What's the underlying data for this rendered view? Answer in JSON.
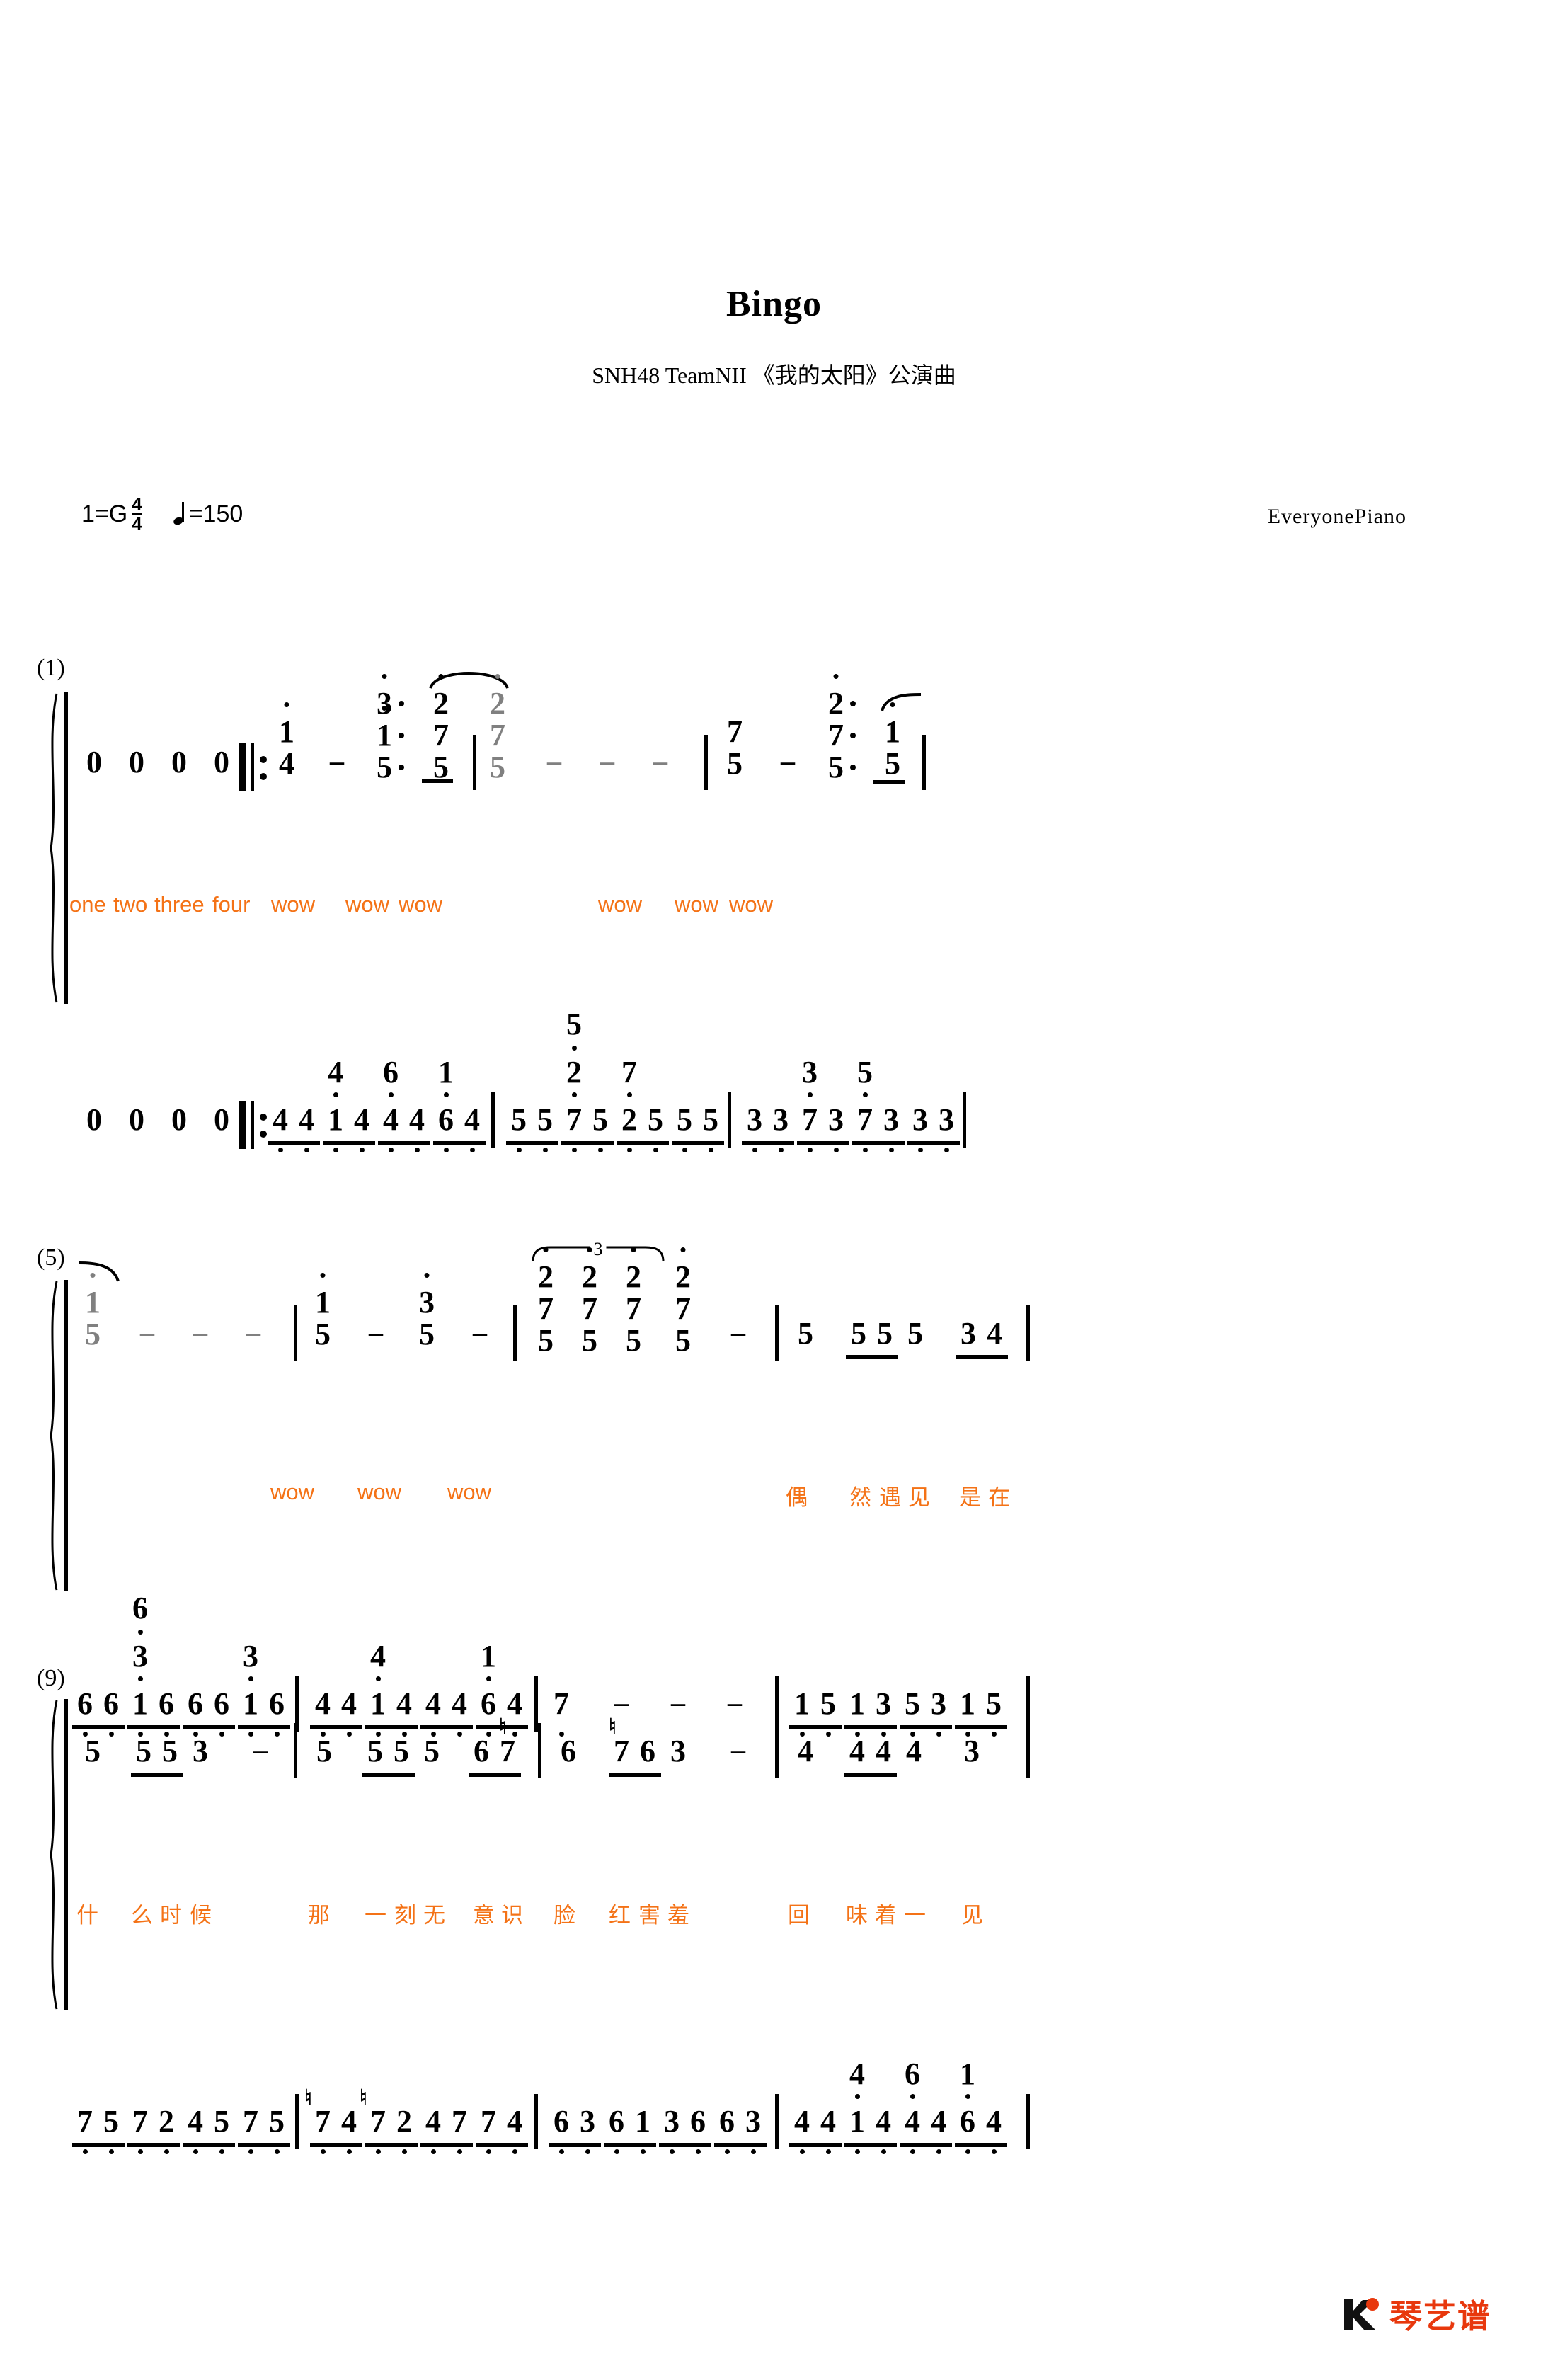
{
  "header": {
    "title": "Bingo",
    "subtitle": "SNH48 TeamNII 《我的太阳》公演曲",
    "key_prefix": "1=G",
    "time_num": "4",
    "time_den": "4",
    "tempo_text": "=150",
    "credit": "EveryonePiano",
    "watermark": "琴艺谱"
  },
  "systems": [
    {
      "number": "(1)",
      "lyrics": [
        "one",
        "two",
        "three",
        "four",
        "wow",
        "wow",
        "wow",
        "wow",
        "wow",
        "wow"
      ],
      "treble": [
        "0",
        "0",
        "0",
        "0",
        "1̇/4",
        "-",
        "3̇·/1̇·/5·",
        "2̇/7/5",
        "2̇/7/5 (tied)",
        "-",
        "-",
        "-",
        "7/5",
        "-",
        "2̇·/7·/5·",
        "1̇/5"
      ],
      "bass": [
        "0",
        "0",
        "0",
        "0",
        "4",
        "4",
        "1̣(4)",
        "4",
        "4",
        "4",
        "6(6)",
        "4",
        "5",
        "5",
        "7(2̇)",
        "5",
        "2",
        "5",
        "5",
        "5",
        "3",
        "3",
        "7(3̇)",
        "3",
        "7(5)",
        "3",
        "3",
        "3"
      ]
    },
    {
      "number": "(5)",
      "lyrics": [
        "wow",
        "wow",
        "wow",
        "偶",
        "然",
        "遇",
        "见",
        "是",
        "在"
      ],
      "treble": [
        "1̇/5 (tied)",
        "-",
        "-",
        "-",
        "1̇/5",
        "-",
        "3̇/5",
        "-",
        "2̇/7/5",
        "2̇/7/5",
        "2̇/7/5",
        "2̇/7/5",
        "-",
        "5",
        "5",
        "5",
        "5",
        "3",
        "4"
      ],
      "bass": [
        "6",
        "6",
        "1̣(6̇/3̇)",
        "6",
        "6",
        "6",
        "1̣(3)",
        "6",
        "4",
        "4",
        "1̣(4)",
        "4",
        "4",
        "4",
        "6(6)",
        "4",
        "7",
        "-",
        "-",
        "-",
        "1̣",
        "5",
        "1̣",
        "3",
        "5",
        "3",
        "1̣",
        "5"
      ]
    },
    {
      "number": "(9)",
      "lyrics": [
        "什",
        "么",
        "时",
        "候",
        "那",
        "一",
        "刻",
        "无",
        "意",
        "识",
        "脸",
        "红",
        "害",
        "羞",
        "回",
        "味",
        "着",
        "一",
        "见"
      ],
      "treble": [
        "5",
        "5",
        "5",
        "3",
        "-",
        "5",
        "5",
        "5",
        "5",
        "6",
        "♮7",
        "6",
        "♮7",
        "6",
        "3",
        "-",
        "4",
        "4",
        "4",
        "4",
        "3"
      ],
      "bass": [
        "7",
        "5",
        "7",
        "2",
        "4",
        "5",
        "7",
        "5",
        "♮7",
        "4",
        "♮7",
        "2",
        "4",
        "7",
        "7",
        "4",
        "6",
        "3",
        "6",
        "1",
        "3",
        "6",
        "6",
        "3",
        "4",
        "4",
        "1̣(4)",
        "4",
        "4",
        "4",
        "6(6)",
        "4"
      ]
    }
  ],
  "chart_data": {
    "type": "table",
    "title": "Bingo - numbered musical notation (jianpu) piano score",
    "measures": 12,
    "key": "1=G",
    "time_signature": "4/4",
    "tempo_bpm": 150
  }
}
